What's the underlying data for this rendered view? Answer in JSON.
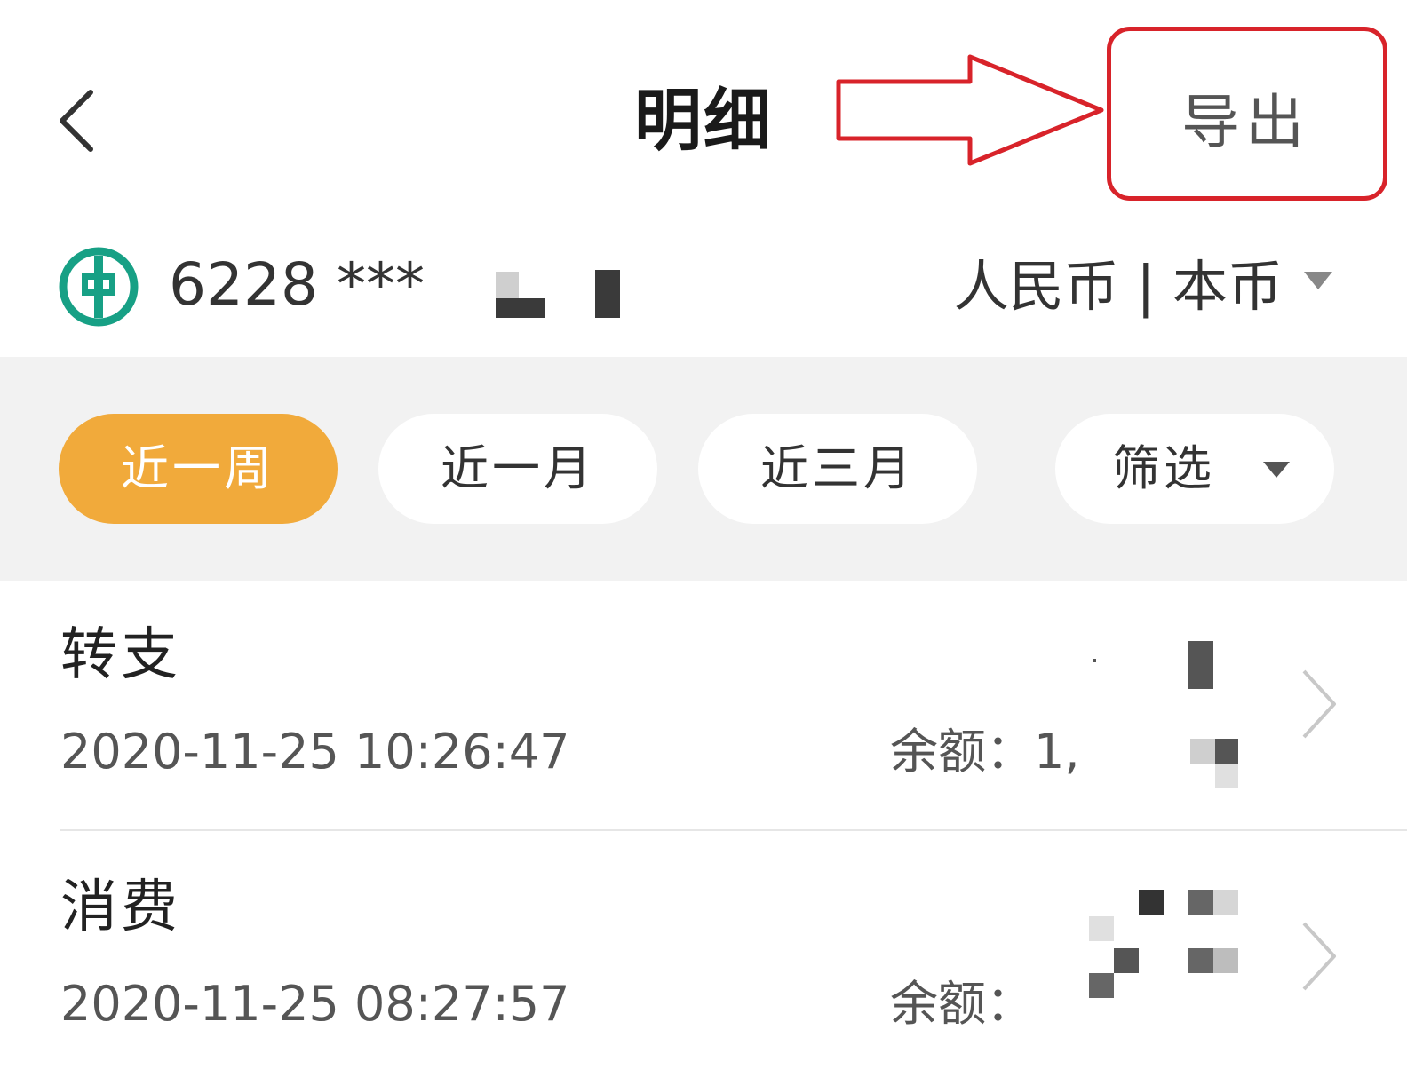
{
  "header": {
    "title": "明细",
    "export_label": "导出"
  },
  "account": {
    "card_number": "6228 ***",
    "currency_label": "人民币 | 本币"
  },
  "filters": [
    {
      "label": "近一周",
      "active": true
    },
    {
      "label": "近一月",
      "active": false
    },
    {
      "label": "近三月",
      "active": false
    },
    {
      "label": "筛选",
      "active": false
    }
  ],
  "transactions": [
    {
      "type": "转支",
      "time": "2020-11-25 10:26:47",
      "balance_label": "余额：1,"
    },
    {
      "type": "消费",
      "time": "2020-11-25 08:27:57",
      "balance_label": "余额："
    }
  ],
  "colors": {
    "accent": "#f1aa3b",
    "annotation": "#d8232a",
    "bank_green": "#17a085"
  }
}
